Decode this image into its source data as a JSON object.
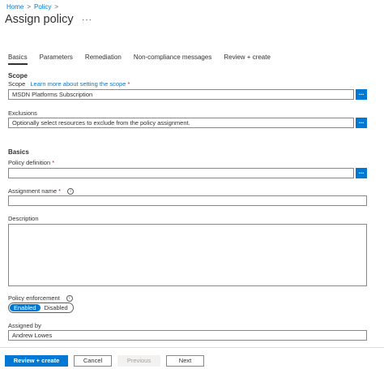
{
  "breadcrumb": {
    "items": [
      "Home",
      "Policy"
    ],
    "separator": ">"
  },
  "page": {
    "title": "Assign policy",
    "more": "···"
  },
  "tabs": [
    "Basics",
    "Parameters",
    "Remediation",
    "Non-compliance messages",
    "Review + create"
  ],
  "scope_section": {
    "heading": "Scope",
    "scope_label": "Scope",
    "learn_more": "Learn more about setting the scope",
    "required_mark": "*",
    "scope_value": "MSDN Platforms Subscription",
    "browse_label": "...",
    "exclusions_label": "Exclusions",
    "exclusions_placeholder": "Optionally select resources to exclude from the policy assignment."
  },
  "basics_section": {
    "heading": "Basics",
    "policy_definition_label": "Policy definition",
    "policy_definition_value": "",
    "assignment_name_label": "Assignment name",
    "assignment_name_value": "",
    "description_label": "Description",
    "description_value": "",
    "enforcement_label": "Policy enforcement",
    "enforcement_options": [
      "Enabled",
      "Disabled"
    ],
    "enforcement_selected": "Enabled",
    "assigned_by_label": "Assigned by",
    "assigned_by_value": "Andrew Lowes"
  },
  "footer": {
    "review_create": "Review + create",
    "cancel": "Cancel",
    "previous": "Previous",
    "next": "Next"
  },
  "colors": {
    "accent": "#0078d4",
    "required": "#a4262c",
    "border": "#8a8886"
  },
  "icons": {
    "info": "info-icon",
    "chevron": "chevron-right-icon"
  }
}
